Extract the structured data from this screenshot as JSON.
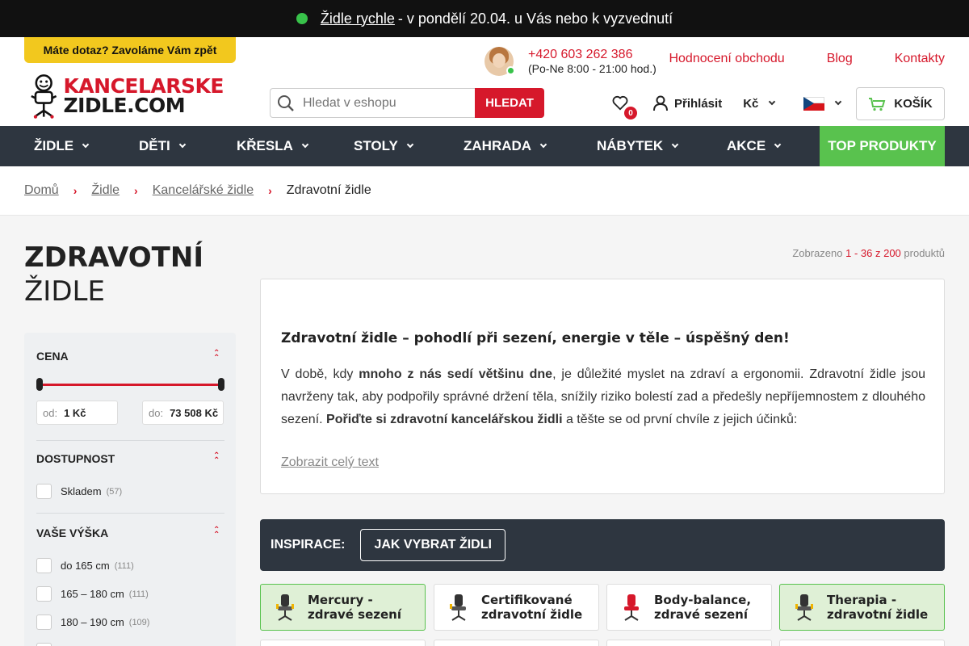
{
  "topbar": {
    "link": "Židle rychle",
    "text": "- v pondělí 20.04. u Vás nebo k vyzvednutí"
  },
  "header": {
    "callback": "Máte dotaz? Zavoláme Vám zpět",
    "logo_line1": "KANCELARSKE",
    "logo_line2": "ZIDLE.COM",
    "phone": "+420 603 262 386",
    "hours": "(Po-Ne 8:00 - 21:00 hod.)",
    "links": [
      "Hodnocení obchodu",
      "Blog",
      "Kontakty"
    ],
    "search_placeholder": "Hledat v eshopu",
    "search_button": "HLEDAT",
    "wishlist_count": "0",
    "login": "Přihlásit",
    "currency": "Kč",
    "cart": "KOŠÍK"
  },
  "nav": {
    "items": [
      "ŽIDLE",
      "DĚTI",
      "KŘESLA",
      "STOLY",
      "ZAHRADA",
      "NÁBYTEK",
      "AKCE"
    ],
    "top": "TOP PRODUKTY"
  },
  "breadcrumb": [
    "Domů",
    "Židle",
    "Kancelářské židle",
    "Zdravotní židle"
  ],
  "page": {
    "title1": "ZDRAVOTNÍ",
    "title2": "ŽIDLE",
    "count_prefix": "Zobrazeno",
    "count_range": "1 - 36 z 200",
    "count_suffix": "produktů"
  },
  "filters": {
    "price": {
      "title": "CENA",
      "from_label": "od:",
      "from": "1 Kč",
      "to_label": "do:",
      "to": "73 508 Kč"
    },
    "availability": {
      "title": "DOSTUPNOST",
      "options": [
        {
          "label": "Skladem",
          "count": "(57)"
        }
      ]
    },
    "height": {
      "title": "VAŠE VÝŠKA",
      "options": [
        {
          "label": "do 165 cm",
          "count": "(111)"
        },
        {
          "label": "165 – 180 cm",
          "count": "(111)"
        },
        {
          "label": "180 – 190 cm",
          "count": "(109)"
        }
      ]
    }
  },
  "description": {
    "heading": "Zdravotní židle – pohodlí při sezení, energie v těle – úspěšný den!",
    "p_part1": "V době, kdy ",
    "p_bold1": "mnoho z nás sedí většinu dne",
    "p_part2": ", je důležité myslet na zdraví a ergonomii. Zdravotní židle jsou navrženy tak, aby podpořily správné držení těla, snížily riziko bolestí zad a předešly nepříjemnostem z dlouhého sezení. ",
    "p_bold2": "Pořiďte si zdravotní kancelářskou židli",
    "p_part3": " a těšte se od první chvíle z jejich účinků:",
    "more": "Zobrazit celý text"
  },
  "inspiration": {
    "label": "INSPIRACE:",
    "button": "JAK VYBRAT ŽIDLI"
  },
  "tiles": [
    {
      "line1": "Mercury -",
      "line2": "zdravé sezení",
      "icon": "chair-icon"
    },
    {
      "line1": "Certifikované",
      "line2": "zdravotní židle",
      "icon": "chair-icon"
    },
    {
      "line1": "Body-balance,",
      "line2": "zdravé sezení",
      "icon": "chair-icon"
    },
    {
      "line1": "Therapia -",
      "line2": "zdravotní židle",
      "icon": "chair-icon"
    }
  ],
  "colors": {
    "accent": "#d6182b",
    "nav": "#2e3640",
    "green": "#59c24e",
    "yellow": "#f2c81e"
  }
}
